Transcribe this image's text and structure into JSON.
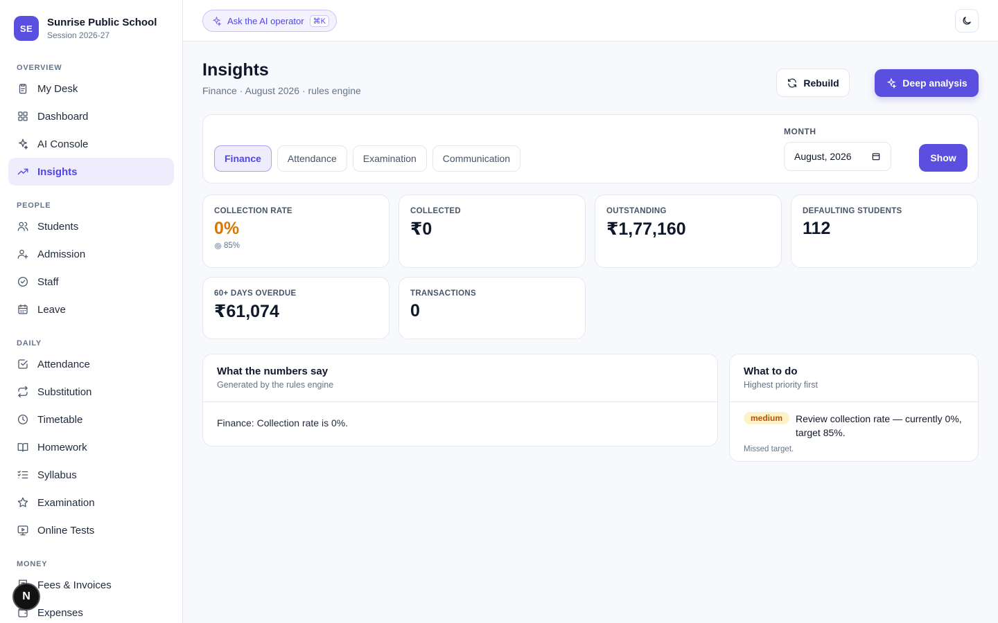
{
  "brand": {
    "initials": "SE",
    "name": "Sunrise Public School",
    "session": "Session 2026-27"
  },
  "sidebar": {
    "sections": [
      {
        "label": "OVERVIEW",
        "items": [
          {
            "label": "My Desk",
            "icon": "clipboard-icon"
          },
          {
            "label": "Dashboard",
            "icon": "grid-icon"
          },
          {
            "label": "AI Console",
            "icon": "sparkles-icon"
          },
          {
            "label": "Insights",
            "icon": "trending-up-icon",
            "active": true
          }
        ]
      },
      {
        "label": "PEOPLE",
        "items": [
          {
            "label": "Students",
            "icon": "users-icon"
          },
          {
            "label": "Admission",
            "icon": "user-plus-icon"
          },
          {
            "label": "Staff",
            "icon": "badge-check-icon"
          },
          {
            "label": "Leave",
            "icon": "calendar-icon"
          }
        ]
      },
      {
        "label": "DAILY",
        "items": [
          {
            "label": "Attendance",
            "icon": "check-square-icon"
          },
          {
            "label": "Substitution",
            "icon": "repeat-icon"
          },
          {
            "label": "Timetable",
            "icon": "clock-icon"
          },
          {
            "label": "Homework",
            "icon": "book-open-icon"
          },
          {
            "label": "Syllabus",
            "icon": "list-checks-icon"
          },
          {
            "label": "Examination",
            "icon": "star-icon"
          },
          {
            "label": "Online Tests",
            "icon": "monitor-play-icon"
          }
        ]
      },
      {
        "label": "MONEY",
        "items": [
          {
            "label": "Fees & Invoices",
            "icon": "receipt-icon"
          },
          {
            "label": "Expenses",
            "icon": "wallet-icon"
          }
        ]
      }
    ],
    "floating_avatar": "N"
  },
  "topbar": {
    "ask_label": "Ask the AI operator",
    "ask_shortcut": "⌘K"
  },
  "header": {
    "title": "Insights",
    "subtitle": "Finance · August 2026 · rules engine",
    "rebuild_label": "Rebuild",
    "deep_label": "Deep analysis"
  },
  "filters": {
    "tabs": [
      {
        "label": "Finance",
        "active": true
      },
      {
        "label": "Attendance"
      },
      {
        "label": "Examination"
      },
      {
        "label": "Communication"
      }
    ],
    "month_label": "MONTH",
    "month_value": "August, 2026",
    "show_label": "Show"
  },
  "stats": [
    {
      "label": "COLLECTION RATE",
      "value": "0%",
      "target": "85%",
      "accent": "#d97706"
    },
    {
      "label": "COLLECTED",
      "value": "₹0"
    },
    {
      "label": "OUTSTANDING",
      "value": "₹1,77,160"
    },
    {
      "label": "DEFAULTING STUDENTS",
      "value": "112"
    },
    {
      "label": "60+ DAYS OVERDUE",
      "value": "₹61,074"
    },
    {
      "label": "TRANSACTIONS",
      "value": "0"
    }
  ],
  "numbers_panel": {
    "title": "What the numbers say",
    "subtitle": "Generated by the rules engine",
    "body": "Finance: Collection rate is 0%."
  },
  "todo_panel": {
    "title": "What to do",
    "subtitle": "Highest priority first",
    "items": [
      {
        "priority": "medium",
        "text": "Review collection rate — currently 0%, target 85%.",
        "note": "Missed target."
      }
    ]
  },
  "colors": {
    "accent": "#5b4fe0",
    "warning": "#d97706"
  }
}
